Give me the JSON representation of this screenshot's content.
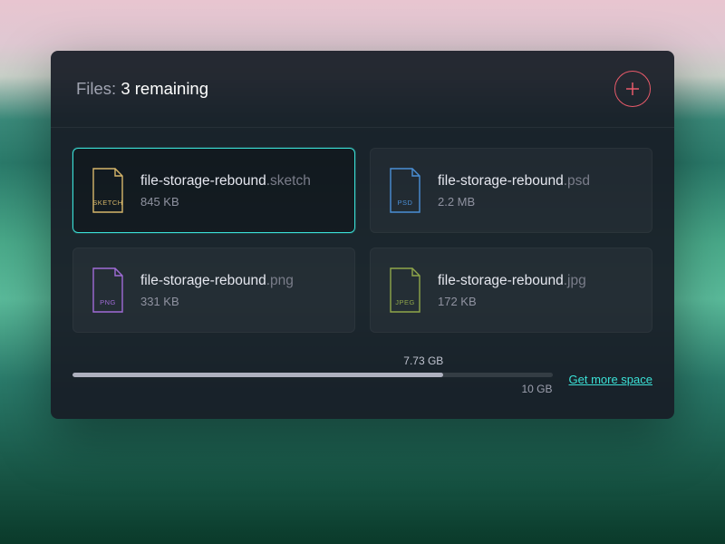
{
  "header": {
    "title_prefix": "Files: ",
    "remaining_text": "3 remaining"
  },
  "colors": {
    "accent_teal": "#3be0d6",
    "accent_red": "#e85a6a",
    "sketch_icon": "#d6b66a",
    "psd_icon": "#4a8fd6",
    "png_icon": "#a06bd6",
    "jpeg_icon": "#8fa64a"
  },
  "files": [
    {
      "basename": "file-storage-rebound",
      "ext": ".sketch",
      "badge": "SKETCH",
      "size": "845 KB",
      "icon_color": "#d6b66a",
      "selected": true
    },
    {
      "basename": "file-storage-rebound",
      "ext": ".psd",
      "badge": "PSD",
      "size": "2.2 MB",
      "icon_color": "#4a8fd6",
      "selected": false
    },
    {
      "basename": "file-storage-rebound",
      "ext": ".png",
      "badge": "PNG",
      "size": "331 KB",
      "icon_color": "#a06bd6",
      "selected": false
    },
    {
      "basename": "file-storage-rebound",
      "ext": ".jpg",
      "badge": "JPEG",
      "size": "172 KB",
      "icon_color": "#8fa64a",
      "selected": false
    }
  ],
  "storage": {
    "used_label": "7.73 GB",
    "used_gb": 7.73,
    "total_label": "10 GB",
    "total_gb": 10,
    "more_space_label": "Get more space"
  }
}
